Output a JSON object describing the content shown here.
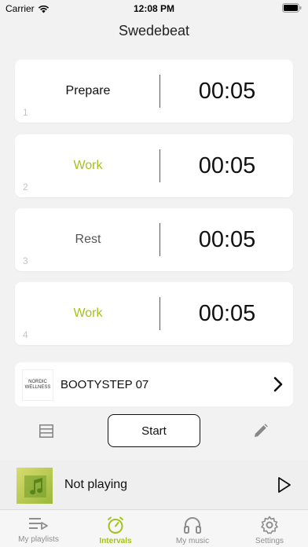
{
  "status_bar": {
    "carrier": "Carrier",
    "time": "12:08 PM"
  },
  "app": {
    "title": "Swedebeat"
  },
  "intervals": [
    {
      "index": "1",
      "label": "Prepare",
      "duration": "00:05",
      "color": "#111111"
    },
    {
      "index": "2",
      "label": "Work",
      "duration": "00:05",
      "color": "#a4c21f"
    },
    {
      "index": "3",
      "label": "Rest",
      "duration": "00:05",
      "color": "#555555"
    },
    {
      "index": "4",
      "label": "Work",
      "duration": "00:05",
      "color": "#a4c21f"
    }
  ],
  "playlist": {
    "name": "BOOTYSTEP 07",
    "logo_text": "NORDIC WELLNESS"
  },
  "controls": {
    "start_label": "Start"
  },
  "player": {
    "status": "Not playing"
  },
  "tabs": [
    {
      "label": "My playlists",
      "icon": "playlist-icon",
      "active": false
    },
    {
      "label": "Intervals",
      "icon": "stopwatch-icon",
      "active": true
    },
    {
      "label": "My music",
      "icon": "headphones-icon",
      "active": false
    },
    {
      "label": "Settings",
      "icon": "gear-icon",
      "active": false
    }
  ],
  "colors": {
    "accent": "#a4c21f"
  }
}
